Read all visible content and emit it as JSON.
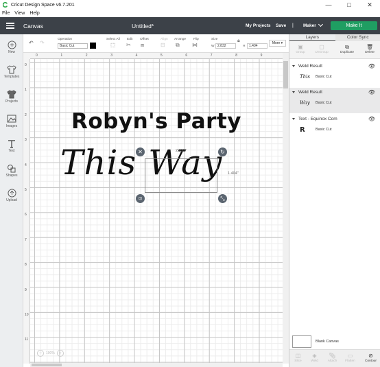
{
  "window": {
    "title": "Cricut Design Space  v6.7.201",
    "minimize": "—",
    "maximize": "□",
    "close": "✕"
  },
  "menu": [
    "File",
    "View",
    "Help"
  ],
  "header": {
    "section": "Canvas",
    "document_title": "Untitled*",
    "my_projects": "My Projects",
    "save": "Save",
    "separator": "|",
    "machine": "Maker",
    "make_it": "Make It",
    "accent_color": "#1f9e62"
  },
  "leftbar": {
    "items": [
      {
        "label": "New",
        "icon": "plus-circle-icon"
      },
      {
        "label": "Templates",
        "icon": "shirt-icon"
      },
      {
        "label": "Projects",
        "icon": "shirt-stack-icon"
      },
      {
        "label": "Images",
        "icon": "image-icon"
      },
      {
        "label": "Text",
        "icon": "text-t-icon"
      },
      {
        "label": "Shapes",
        "icon": "shapes-icon"
      },
      {
        "label": "Upload",
        "icon": "upload-icon"
      }
    ]
  },
  "toolbar": {
    "operation_label": "Operation",
    "operation_value": "Basic Cut",
    "operation_color": "#000000",
    "select_all": "Select All",
    "edit": "Edit",
    "offset": "Offset",
    "align": "Align",
    "arrange": "Arrange",
    "flip": "Flip",
    "size": "Size",
    "size_w_label": "W",
    "size_w": "2.832",
    "size_h_label": "H",
    "size_h": "1.404",
    "more": "More"
  },
  "ruler": {
    "top": [
      "0",
      "1",
      "2",
      "3",
      "4",
      "5",
      "6",
      "7",
      "8",
      "9"
    ],
    "left": [
      "0",
      "1",
      "2",
      "3",
      "4",
      "5",
      "6",
      "7",
      "8",
      "9",
      "10",
      "11"
    ]
  },
  "canvas": {
    "text_title": "Robyn's Party",
    "text_script": "This Way",
    "selection_width": "2.832\"",
    "selection_height": "1.404\"",
    "zoom": "100%",
    "zoom_minus": "−",
    "zoom_plus": "+"
  },
  "layers": {
    "tab_layers": "Layers",
    "tab_color_sync": "Color Sync",
    "actions": [
      {
        "label": "Group",
        "enabled": false
      },
      {
        "label": "UnGroup",
        "enabled": false
      },
      {
        "label": "Duplicate",
        "enabled": true
      },
      {
        "label": "Delete",
        "enabled": true
      }
    ],
    "groups": [
      {
        "name": "Weld Result",
        "item": "Basic Cut",
        "thumb": "This",
        "selected": false
      },
      {
        "name": "Weld Result",
        "item": "Basic Cut",
        "thumb": "Way",
        "selected": true
      },
      {
        "name": "Text - Equinox Com",
        "item": "Basic Cut",
        "thumb": "R",
        "selected": false
      }
    ],
    "blank_canvas": "Blank Canvas",
    "bottom_actions": [
      {
        "label": "Slice",
        "enabled": false
      },
      {
        "label": "Weld",
        "enabled": false
      },
      {
        "label": "Attach",
        "enabled": false
      },
      {
        "label": "Flatten",
        "enabled": false
      },
      {
        "label": "Contour",
        "enabled": true
      }
    ]
  }
}
